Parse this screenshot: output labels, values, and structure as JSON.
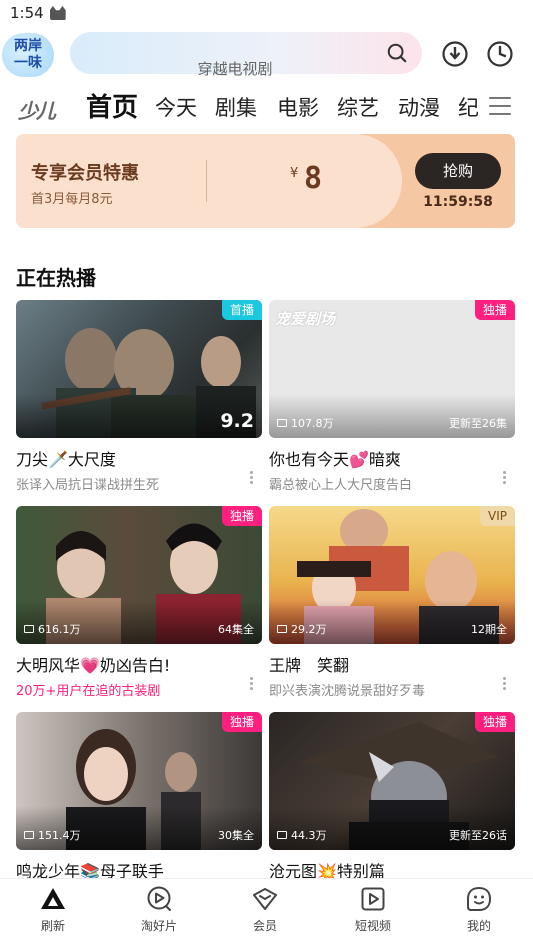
{
  "status_bar": {
    "time": "1:54"
  },
  "header": {
    "logo_text": "两岸一味",
    "search_placeholder": "穿越电视剧"
  },
  "nav": {
    "kids_label": "少儿",
    "tabs": [
      "首页",
      "今天",
      "剧集",
      "电影",
      "综艺",
      "动漫",
      "纪"
    ]
  },
  "vip_banner": {
    "title": "专享会员特惠",
    "subtitle": "首3月每月8元",
    "currency": "¥",
    "price": "8",
    "buy_label": "抢购",
    "countdown": "11:59:58"
  },
  "section_title": "正在热播",
  "cards": [
    {
      "title": "刀尖🗡️大尺度",
      "subtitle": "张译入局抗日谍战拼生死",
      "badge": "首播",
      "badge_color": "cyan",
      "rating": "9.2",
      "views": "",
      "episodes": "",
      "subtitle_highlight": false
    },
    {
      "title": "你也有今天💕暗爽",
      "subtitle": "霸总被心上人大尺度告白",
      "badge": "独播",
      "badge_color": "pink",
      "rating": "",
      "views": "107.8万",
      "episodes": "更新至26集",
      "watermark": "宠爱剧场",
      "subtitle_highlight": false
    },
    {
      "title": "大明风华💗奶凶告白!",
      "subtitle": "20万+用户在追的古装剧",
      "badge": "独播",
      "badge_color": "pink",
      "rating": "",
      "views": "616.1万",
      "episodes": "64集全",
      "subtitle_highlight": true
    },
    {
      "title": "王牌　笑翻",
      "subtitle": "即兴表演沈腾说景甜好歹毒",
      "badge": "VIP",
      "badge_color": "gold",
      "rating": "",
      "views": "29.2万",
      "episodes": "12期全",
      "subtitle_highlight": false
    },
    {
      "title": "鸣龙少年📚母子联手",
      "subtitle": "",
      "badge": "独播",
      "badge_color": "pink",
      "rating": "",
      "views": "151.4万",
      "episodes": "30集全",
      "subtitle_highlight": false
    },
    {
      "title": "沧元图💥特别篇",
      "subtitle": "",
      "badge": "独播",
      "badge_color": "pink",
      "rating": "",
      "views": "44.3万",
      "episodes": "更新至26话",
      "subtitle_highlight": false
    }
  ],
  "tab_bar": [
    {
      "label": "刷新",
      "icon": "refresh-triangle-icon",
      "active": true
    },
    {
      "label": "淘好片",
      "icon": "play-circle-icon",
      "active": false
    },
    {
      "label": "会员",
      "icon": "diamond-icon",
      "active": false
    },
    {
      "label": "短视频",
      "icon": "play-square-icon",
      "active": false
    },
    {
      "label": "我的",
      "icon": "profile-face-icon",
      "active": false
    }
  ],
  "colors": {
    "accent_pink": "#ff1f7e",
    "badge_cyan": "#1cc7e0",
    "vip_banner": "#fbe1cd",
    "vip_dark": "#2b2524"
  }
}
